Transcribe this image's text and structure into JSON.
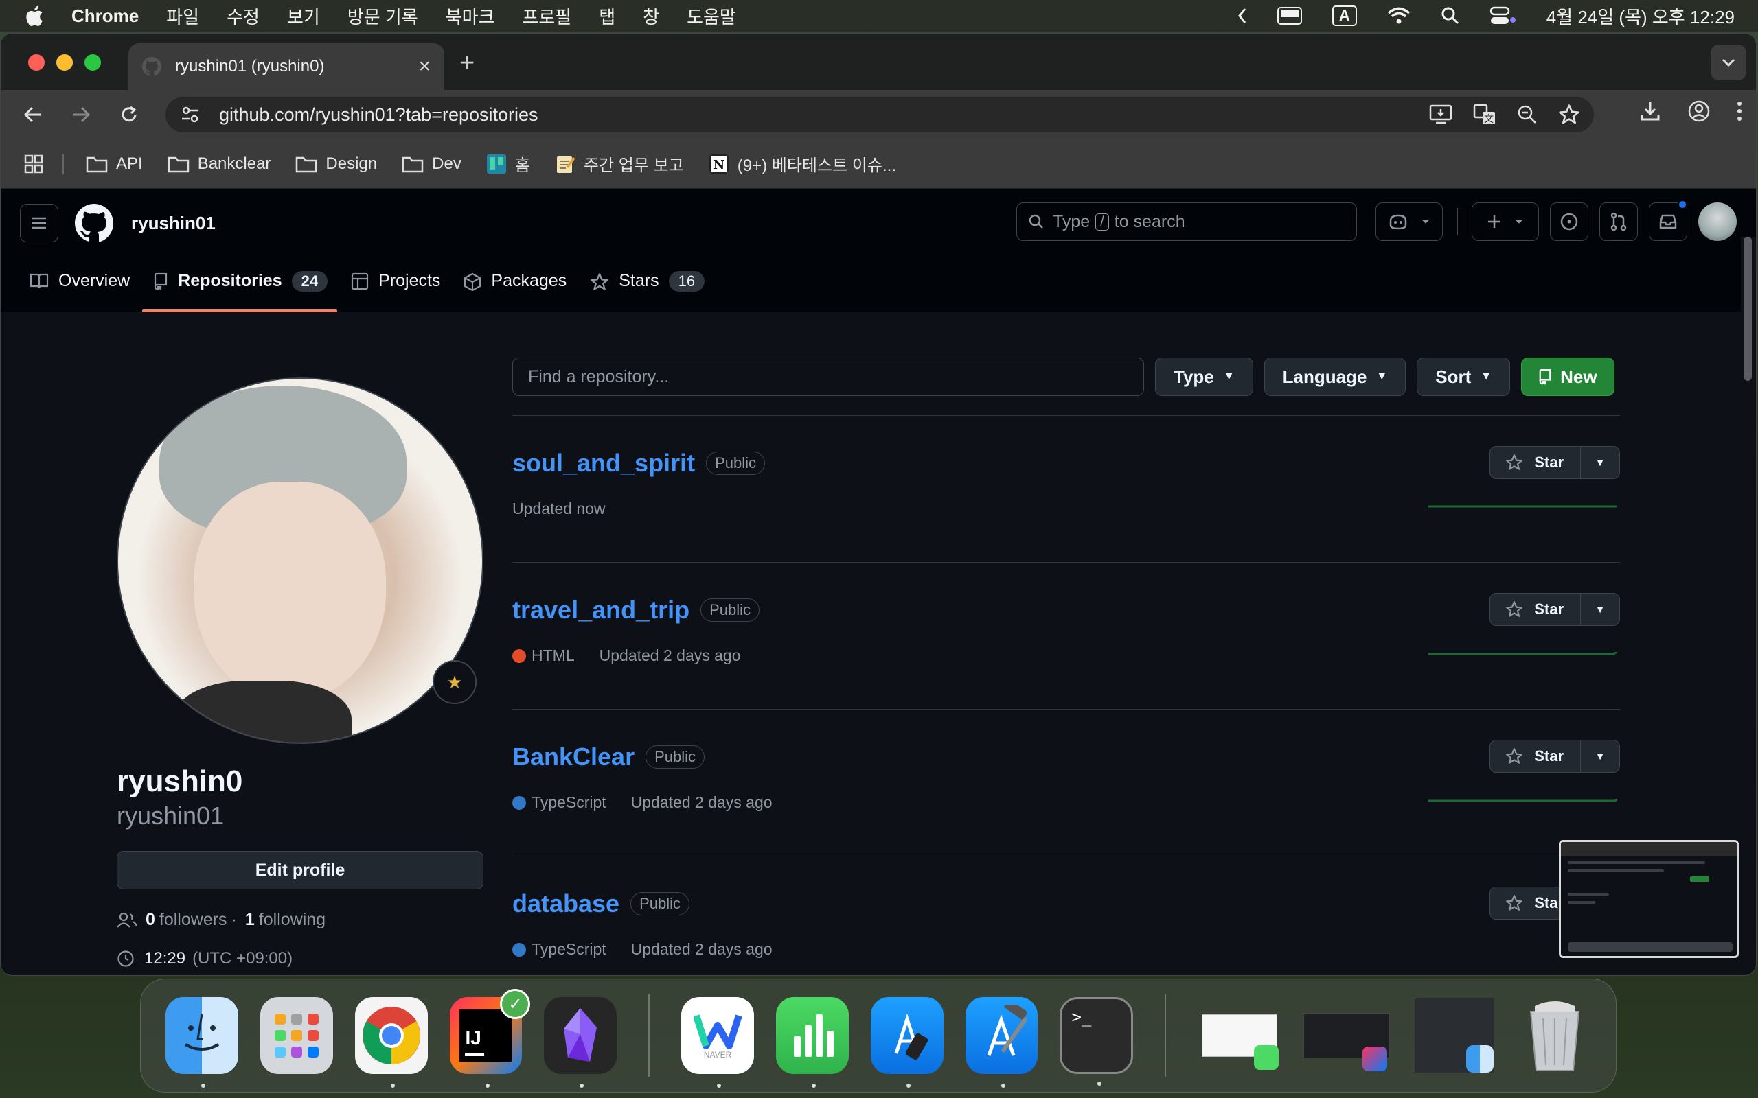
{
  "menubar": {
    "app_name": "Chrome",
    "items": [
      "파일",
      "수정",
      "보기",
      "방문 기록",
      "북마크",
      "프로필",
      "탭",
      "창",
      "도움말"
    ],
    "input_indicator": "A",
    "datetime": "4월 24일 (목) 오후 12:29"
  },
  "browser": {
    "tab_title": "ryushin01 (ryushin0)",
    "url": "github.com/ryushin01?tab=repositories",
    "bookmarks": [
      "API",
      "Bankclear",
      "Design",
      "Dev",
      "홈",
      "주간 업무 보고",
      "(9+) 베타테스트 이슈..."
    ]
  },
  "github": {
    "username": "ryushin01",
    "search_prefix": "Type",
    "search_key": "/",
    "search_suffix": "to search",
    "tabs": [
      {
        "label": "Overview",
        "count": ""
      },
      {
        "label": "Repositories",
        "count": "24"
      },
      {
        "label": "Projects",
        "count": ""
      },
      {
        "label": "Packages",
        "count": ""
      },
      {
        "label": "Stars",
        "count": "16"
      }
    ],
    "profile": {
      "display_name": "ryushin0",
      "login": "ryushin01",
      "edit_label": "Edit profile",
      "followers_count": "0",
      "followers_label": "followers",
      "following_count": "1",
      "following_label": "following",
      "local_time": "12:29",
      "timezone": "(UTC +09:00)"
    },
    "filters": {
      "find_placeholder": "Find a repository...",
      "type_label": "Type",
      "language_label": "Language",
      "sort_label": "Sort",
      "new_label": "New"
    },
    "repos": [
      {
        "name": "soul_and_spirit",
        "visibility": "Public",
        "language": "",
        "lang_color": "",
        "updated": "Updated now"
      },
      {
        "name": "travel_and_trip",
        "visibility": "Public",
        "language": "HTML",
        "lang_color": "#e34c26",
        "updated": "Updated 2 days ago"
      },
      {
        "name": "BankClear",
        "visibility": "Public",
        "language": "TypeScript",
        "lang_color": "#3178c6",
        "updated": "Updated 2 days ago"
      },
      {
        "name": "database",
        "visibility": "Public",
        "language": "TypeScript",
        "lang_color": "#3178c6",
        "updated": "Updated 2 days ago"
      }
    ],
    "star_label": "Star"
  },
  "dock": {
    "apps": [
      "finder-icon",
      "launchpad-icon",
      "chrome-icon",
      "intellij-icon",
      "obsidian-icon",
      "naver-whale-icon",
      "numbers-icon",
      "simulator-icon",
      "xcode-icon",
      "terminal-icon"
    ],
    "naver_label": "NAVER"
  },
  "colors": {
    "accent_link": "#4493f8",
    "primary_button": "#238636",
    "active_tab_underline": "#f78166",
    "background": "#0d1117"
  }
}
